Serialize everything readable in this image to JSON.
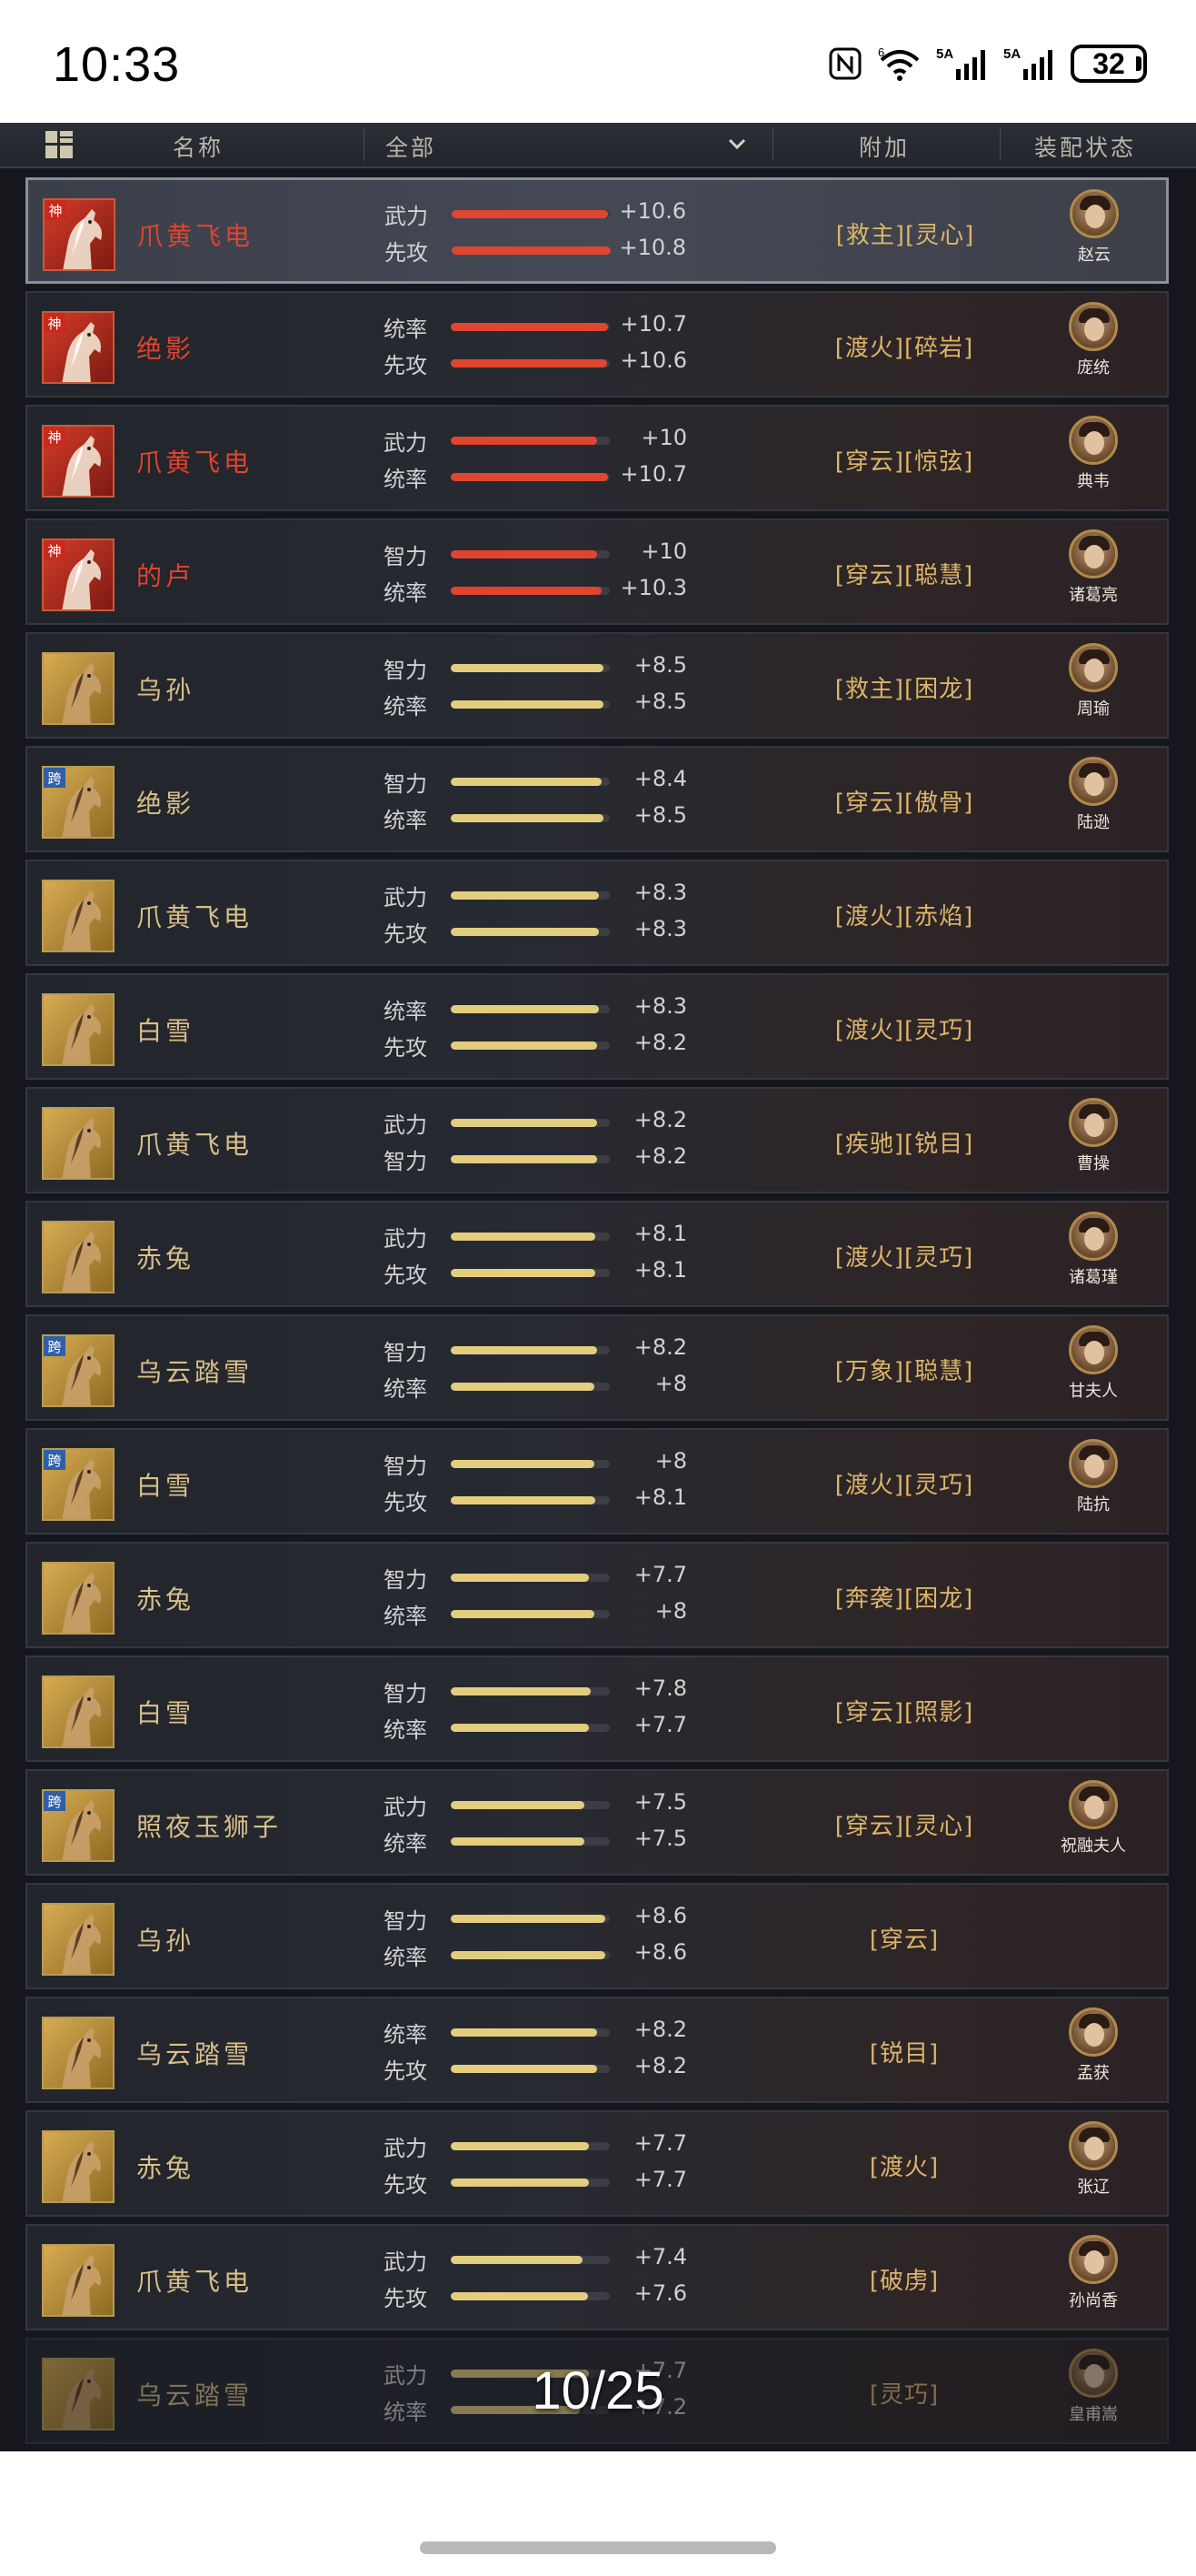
{
  "status_bar": {
    "time": "10:33",
    "nfc_icon": "N",
    "wifi_label": "6",
    "signal1_label": "5A",
    "signal2_label": "5A",
    "battery": "32"
  },
  "header": {
    "name_col": "名称",
    "filter_col": "全部",
    "extra_col": "附加",
    "status_col": "装配状态"
  },
  "rows": [
    {
      "name": "爪黄飞电",
      "tier": "red",
      "badge": "神",
      "stat1": "武力",
      "val1": "+10.6",
      "fill1": 0.98,
      "stat2": "先攻",
      "val2": "+10.8",
      "fill2": 1.0,
      "skills": "[救主][灵心]",
      "general": "赵云"
    },
    {
      "name": "绝影",
      "tier": "red",
      "badge": "神",
      "stat1": "统率",
      "val1": "+10.7",
      "fill1": 0.99,
      "stat2": "先攻",
      "val2": "+10.6",
      "fill2": 0.98,
      "skills": "[渡火][碎岩]",
      "general": "庞统"
    },
    {
      "name": "爪黄飞电",
      "tier": "red",
      "badge": "神",
      "stat1": "武力",
      "val1": "+10",
      "fill1": 0.92,
      "stat2": "统率",
      "val2": "+10.7",
      "fill2": 0.99,
      "skills": "[穿云][惊弦]",
      "general": "典韦"
    },
    {
      "name": "的卢",
      "tier": "red",
      "badge": "神",
      "stat1": "智力",
      "val1": "+10",
      "fill1": 0.92,
      "stat2": "统率",
      "val2": "+10.3",
      "fill2": 0.95,
      "skills": "[穿云][聪慧]",
      "general": "诸葛亮"
    },
    {
      "name": "乌孙",
      "tier": "gold",
      "badge": "",
      "stat1": "智力",
      "val1": "+8.5",
      "fill1": 0.96,
      "stat2": "统率",
      "val2": "+8.5",
      "fill2": 0.96,
      "skills": "[救主][困龙]",
      "general": "周瑜"
    },
    {
      "name": "绝影",
      "tier": "gold",
      "badge": "跨",
      "stat1": "智力",
      "val1": "+8.4",
      "fill1": 0.95,
      "stat2": "统率",
      "val2": "+8.5",
      "fill2": 0.96,
      "skills": "[穿云][傲骨]",
      "general": "陆逊"
    },
    {
      "name": "爪黄飞电",
      "tier": "gold",
      "badge": "",
      "stat1": "武力",
      "val1": "+8.3",
      "fill1": 0.93,
      "stat2": "先攻",
      "val2": "+8.3",
      "fill2": 0.93,
      "skills": "[渡火][赤焰]",
      "general": ""
    },
    {
      "name": "白雪",
      "tier": "gold",
      "badge": "",
      "stat1": "统率",
      "val1": "+8.3",
      "fill1": 0.93,
      "stat2": "先攻",
      "val2": "+8.2",
      "fill2": 0.92,
      "skills": "[渡火][灵巧]",
      "general": ""
    },
    {
      "name": "爪黄飞电",
      "tier": "gold",
      "badge": "",
      "stat1": "武力",
      "val1": "+8.2",
      "fill1": 0.92,
      "stat2": "智力",
      "val2": "+8.2",
      "fill2": 0.92,
      "skills": "[疾驰][锐目]",
      "general": "曹操"
    },
    {
      "name": "赤兔",
      "tier": "gold",
      "badge": "",
      "stat1": "武力",
      "val1": "+8.1",
      "fill1": 0.91,
      "stat2": "先攻",
      "val2": "+8.1",
      "fill2": 0.91,
      "skills": "[渡火][灵巧]",
      "general": "诸葛瑾"
    },
    {
      "name": "乌云踏雪",
      "tier": "gold",
      "badge": "跨",
      "stat1": "智力",
      "val1": "+8.2",
      "fill1": 0.92,
      "stat2": "统率",
      "val2": "+8",
      "fill2": 0.9,
      "skills": "[万象][聪慧]",
      "general": "甘夫人"
    },
    {
      "name": "白雪",
      "tier": "gold",
      "badge": "跨",
      "stat1": "智力",
      "val1": "+8",
      "fill1": 0.9,
      "stat2": "先攻",
      "val2": "+8.1",
      "fill2": 0.91,
      "skills": "[渡火][灵巧]",
      "general": "陆抗"
    },
    {
      "name": "赤兔",
      "tier": "gold",
      "badge": "",
      "stat1": "智力",
      "val1": "+7.7",
      "fill1": 0.87,
      "stat2": "统率",
      "val2": "+8",
      "fill2": 0.9,
      "skills": "[奔袭][困龙]",
      "general": ""
    },
    {
      "name": "白雪",
      "tier": "gold",
      "badge": "",
      "stat1": "智力",
      "val1": "+7.8",
      "fill1": 0.88,
      "stat2": "统率",
      "val2": "+7.7",
      "fill2": 0.87,
      "skills": "[穿云][照影]",
      "general": ""
    },
    {
      "name": "照夜玉狮子",
      "tier": "gold",
      "badge": "跨",
      "stat1": "武力",
      "val1": "+7.5",
      "fill1": 0.84,
      "stat2": "统率",
      "val2": "+7.5",
      "fill2": 0.84,
      "skills": "[穿云][灵心]",
      "general": "祝融夫人"
    },
    {
      "name": "乌孙",
      "tier": "gold",
      "badge": "",
      "stat1": "智力",
      "val1": "+8.6",
      "fill1": 0.97,
      "stat2": "统率",
      "val2": "+8.6",
      "fill2": 0.97,
      "skills": "[穿云]",
      "general": ""
    },
    {
      "name": "乌云踏雪",
      "tier": "gold",
      "badge": "",
      "stat1": "统率",
      "val1": "+8.2",
      "fill1": 0.92,
      "stat2": "先攻",
      "val2": "+8.2",
      "fill2": 0.92,
      "skills": "[锐目]",
      "general": "孟获"
    },
    {
      "name": "赤兔",
      "tier": "gold",
      "badge": "",
      "stat1": "武力",
      "val1": "+7.7",
      "fill1": 0.87,
      "stat2": "先攻",
      "val2": "+7.7",
      "fill2": 0.87,
      "skills": "[渡火]",
      "general": "张辽"
    },
    {
      "name": "爪黄飞电",
      "tier": "gold",
      "badge": "",
      "stat1": "武力",
      "val1": "+7.4",
      "fill1": 0.83,
      "stat2": "先攻",
      "val2": "+7.6",
      "fill2": 0.86,
      "skills": "[破虏]",
      "general": "孙尚香"
    },
    {
      "name": "乌云踏雪",
      "tier": "gold",
      "badge": "",
      "stat1": "武力",
      "val1": "+7.7",
      "fill1": 0.87,
      "stat2": "统率",
      "val2": "+7.2",
      "fill2": 0.81,
      "skills": "[灵巧]",
      "general": "皇甫嵩"
    }
  ],
  "page_indicator": "10/25"
}
